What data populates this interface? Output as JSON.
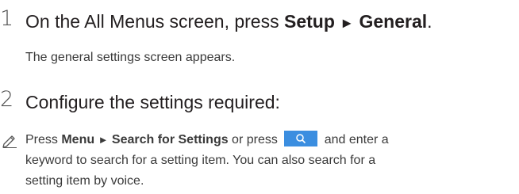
{
  "step1": {
    "number": "1",
    "text_before": "On the All Menus screen, press ",
    "bold_1": "Setup",
    "arrow": "►",
    "bold_2": "General",
    "text_after": ".",
    "result": "The general settings screen appears."
  },
  "step2": {
    "number": "2",
    "text": "Configure the settings required:"
  },
  "note": {
    "icon": "pencil-note-icon",
    "text_press": "Press ",
    "bold_menu": "Menu",
    "arrow": "►",
    "bold_search": "Search for Settings",
    "text_or_press": " or press ",
    "search_button_icon": "search-icon",
    "text_line1_end": " and enter a",
    "line2": "keyword to search for a setting item. You can also search for a",
    "line3": "setting item by voice.",
    "button_color": "#3b8ee0"
  }
}
